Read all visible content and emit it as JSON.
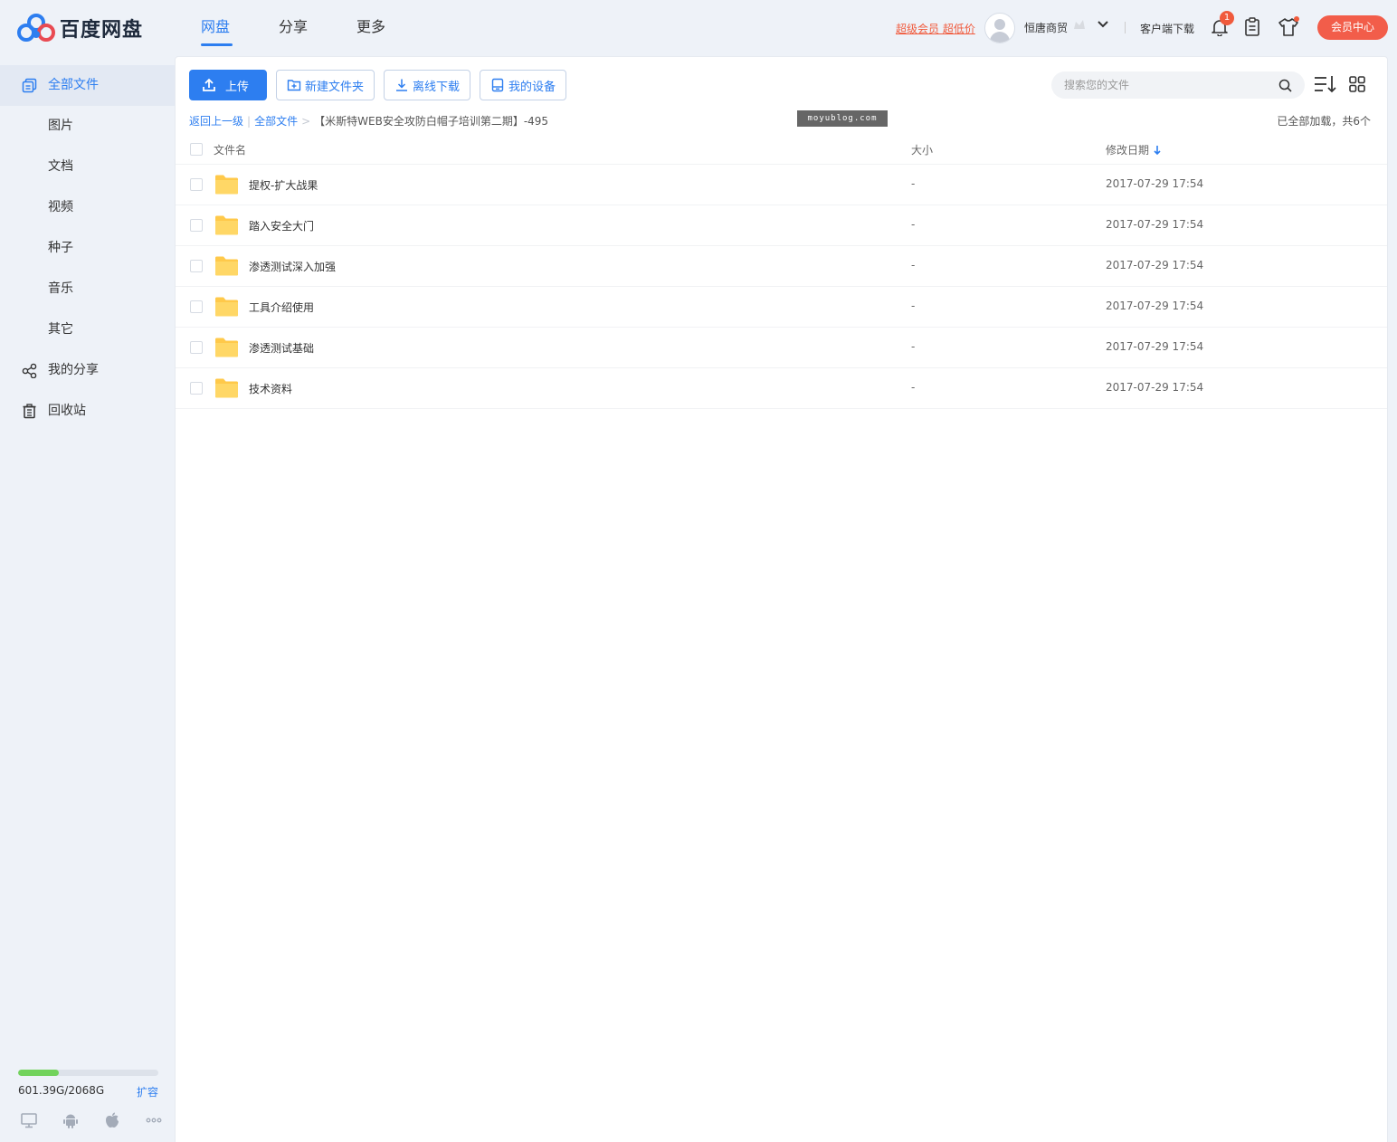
{
  "app": {
    "logo_text": "百度网盘",
    "nav": [
      {
        "label": "网盘",
        "active": true
      },
      {
        "label": "分享",
        "active": false
      },
      {
        "label": "更多",
        "active": false
      }
    ]
  },
  "header": {
    "vip_promo": "超级会员 超低价",
    "username": "恒唐商贸",
    "client_download": "客户端下载",
    "notification_count": "1",
    "vip_center": "会员中心"
  },
  "sidebar": {
    "items": [
      {
        "label": "全部文件",
        "icon": "all-files-icon",
        "active": true
      },
      {
        "label": "图片",
        "icon": "",
        "active": false
      },
      {
        "label": "文档",
        "icon": "",
        "active": false
      },
      {
        "label": "视频",
        "icon": "",
        "active": false
      },
      {
        "label": "种子",
        "icon": "",
        "active": false
      },
      {
        "label": "音乐",
        "icon": "",
        "active": false
      },
      {
        "label": "其它",
        "icon": "",
        "active": false
      },
      {
        "label": "我的分享",
        "icon": "share-icon",
        "active": false
      },
      {
        "label": "回收站",
        "icon": "trash-icon",
        "active": false
      }
    ],
    "storage": {
      "text": "601.39G/2068G",
      "used_fraction": 0.29,
      "expand_label": "扩容"
    }
  },
  "toolbar": {
    "upload_label": "上传",
    "new_folder_label": "新建文件夹",
    "offline_download_label": "离线下载",
    "my_devices_label": "我的设备"
  },
  "search": {
    "placeholder": "搜索您的文件"
  },
  "breadcrumb": {
    "back": "返回上一级",
    "root": "全部文件",
    "current": "【米斯特WEB安全攻防白帽子培训第二期】-495"
  },
  "watermark": "moyublog.com",
  "loaded_info": "已全部加载，共6个",
  "table": {
    "headers": {
      "name": "文件名",
      "size": "大小",
      "date": "修改日期"
    },
    "rows": [
      {
        "name": "提权-扩大战果",
        "size": "-",
        "date": "2017-07-29 17:54"
      },
      {
        "name": "踏入安全大门",
        "size": "-",
        "date": "2017-07-29 17:54"
      },
      {
        "name": "渗透测试深入加强",
        "size": "-",
        "date": "2017-07-29 17:54"
      },
      {
        "name": "工具介绍使用",
        "size": "-",
        "date": "2017-07-29 17:54"
      },
      {
        "name": "渗透测试基础",
        "size": "-",
        "date": "2017-07-29 17:54"
      },
      {
        "name": "技术资料",
        "size": "-",
        "date": "2017-07-29 17:54"
      }
    ]
  },
  "colors": {
    "accent": "#2d7ef0",
    "promo": "#f05a3c",
    "folder": "#ffc94a",
    "storage_fill": "#72d35c"
  }
}
